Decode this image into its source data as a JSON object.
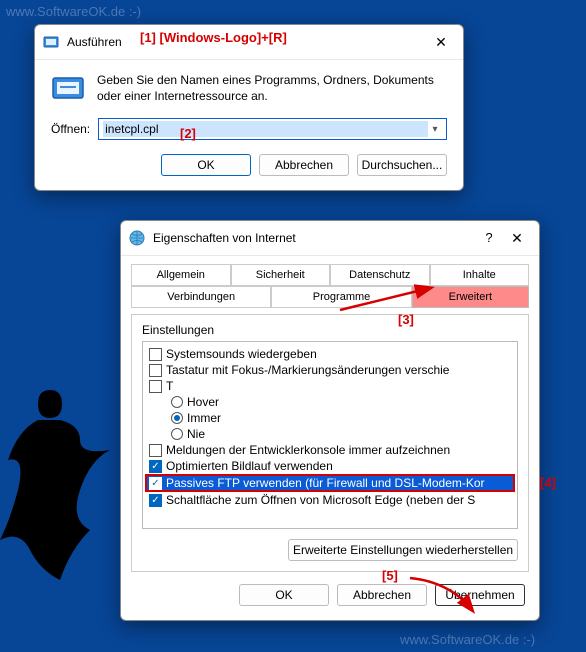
{
  "watermarks": {
    "w1": "www.SoftwareOK.de :-)",
    "w2": "www.SoftwareOK.de :-)",
    "w3": "www.SoftwareOK.de :-)",
    "w4": "www.SoftwareOK.de :-)",
    "w5": "www.SoftwareOK.de :-)"
  },
  "run": {
    "title": "Ausführen",
    "desc": "Geben Sie den Namen eines Programms, Ordners, Dokuments oder einer Internetressource an.",
    "open_label": "Öffnen:",
    "value": "inetcpl.cpl",
    "ok": "OK",
    "cancel": "Abbrechen",
    "browse": "Durchsuchen..."
  },
  "annot": {
    "a1": "[1] [Windows-Logo]+[R]",
    "a2": "[2]",
    "a3": "[3]",
    "a4": "[4]",
    "a5": "[5]"
  },
  "props": {
    "title": "Eigenschaften von Internet",
    "help": "?",
    "close": "✕",
    "tabs_row1": [
      "Allgemein",
      "Sicherheit",
      "Datenschutz",
      "Inhalte"
    ],
    "tabs_row2": [
      "Verbindungen",
      "Programme",
      "Erweitert"
    ],
    "panel_label": "Einstellungen",
    "options": [
      {
        "type": "chk",
        "checked": false,
        "label": "Systemsounds wiedergeben",
        "indent": false
      },
      {
        "type": "chk",
        "checked": false,
        "label": "Tastatur mit Fokus-/Markierungsänderungen verschie",
        "indent": false
      },
      {
        "type": "cut",
        "label": "T",
        "indent": false
      },
      {
        "type": "radio",
        "sel": false,
        "label": "Hover",
        "indent": true
      },
      {
        "type": "radio",
        "sel": true,
        "label": "Immer",
        "indent": true
      },
      {
        "type": "radio",
        "sel": false,
        "label": "Nie",
        "indent": true
      },
      {
        "type": "chk",
        "checked": false,
        "label": "Meldungen der Entwicklerkonsole immer aufzeichnen",
        "indent": false
      },
      {
        "type": "chk",
        "checked": true,
        "label": "Optimierten Bildlauf verwenden",
        "indent": false
      },
      {
        "type": "chk",
        "checked": true,
        "label": "Passives FTP verwenden (für Firewall und DSL-Modem-Kor",
        "indent": false,
        "highlight": true
      },
      {
        "type": "chk",
        "checked": true,
        "label": "Schaltfläche zum Öffnen von Microsoft Edge (neben der S",
        "indent": false
      }
    ],
    "restore": "Erweiterte Einstellungen wiederherstellen",
    "ok": "OK",
    "cancel": "Abbrechen",
    "apply": "Übernehmen"
  }
}
